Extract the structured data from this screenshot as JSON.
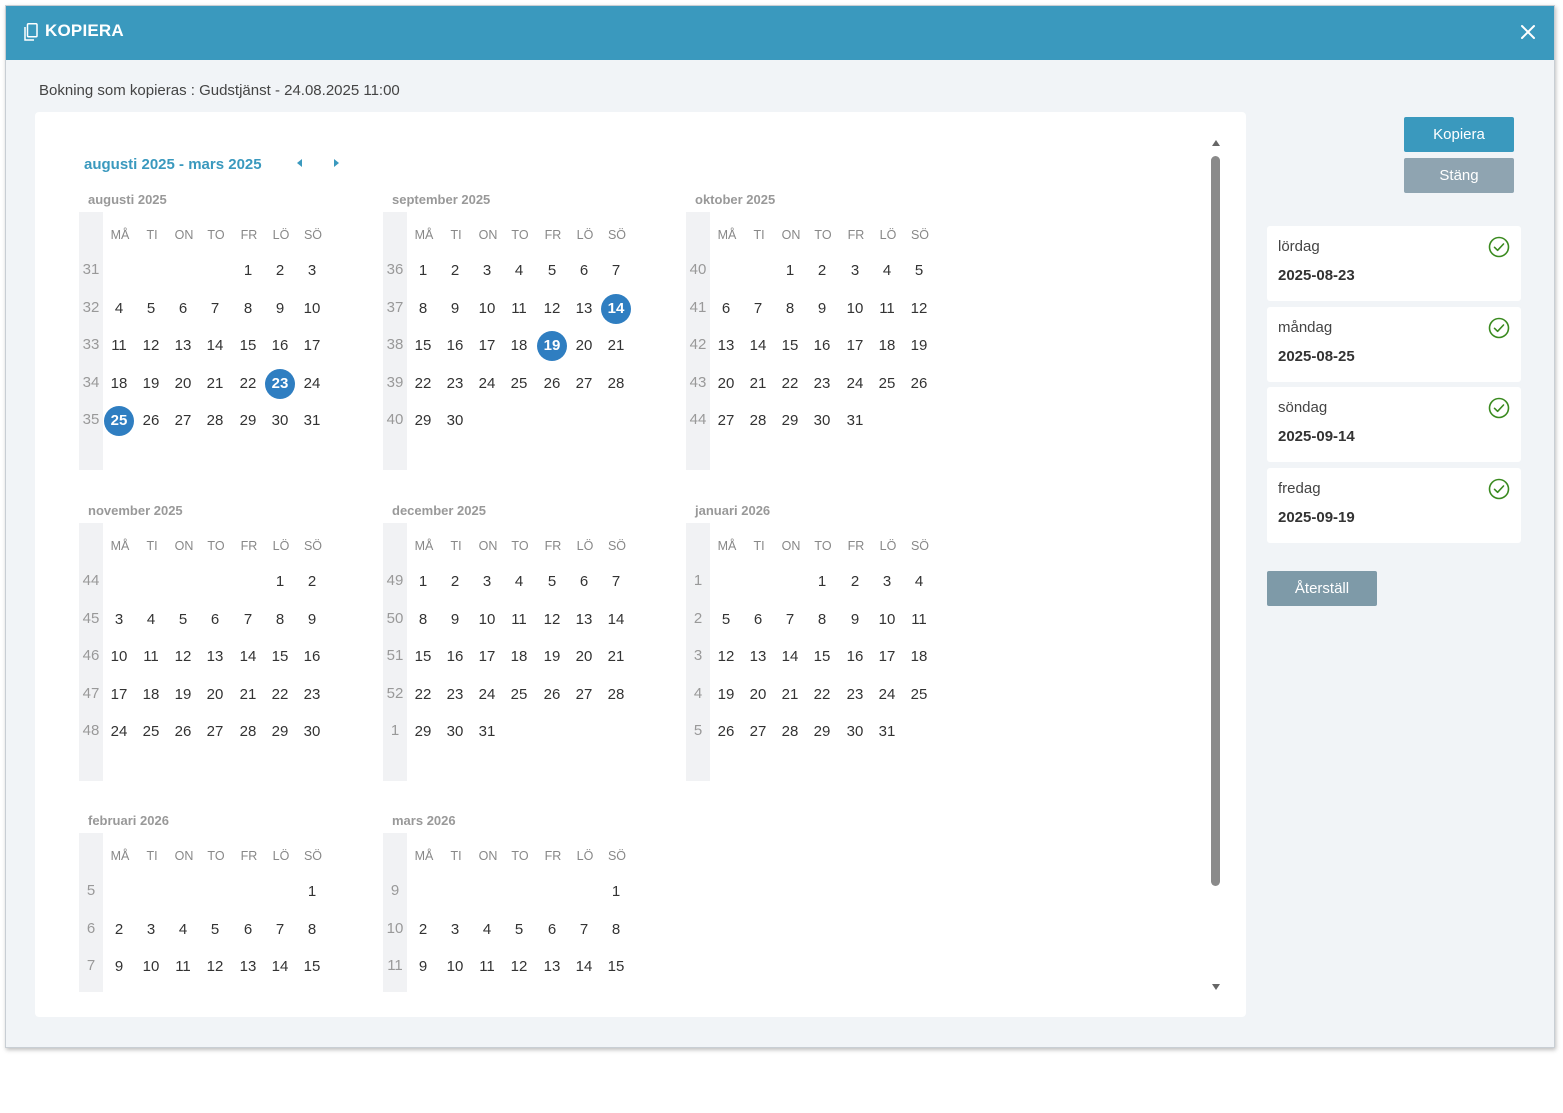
{
  "dialog": {
    "title": "KOPIERA",
    "subtitle": "Bokning som kopieras : Gudstjänst - 24.08.2025 11:00"
  },
  "calendar": {
    "range_title": "augusti 2025 - mars 2025",
    "weekdays": [
      "MÅ",
      "TI",
      "ON",
      "TO",
      "FR",
      "LÖ",
      "SÖ"
    ],
    "months": [
      {
        "title": "augusti 2025",
        "weeks": [
          {
            "wk": "31",
            "days": [
              "",
              "",
              "",
              "",
              "1",
              "2",
              "3"
            ]
          },
          {
            "wk": "32",
            "days": [
              "4",
              "5",
              "6",
              "7",
              "8",
              "9",
              "10"
            ]
          },
          {
            "wk": "33",
            "days": [
              "11",
              "12",
              "13",
              "14",
              "15",
              "16",
              "17"
            ]
          },
          {
            "wk": "34",
            "days": [
              "18",
              "19",
              "20",
              "21",
              "22",
              "23",
              "24"
            ]
          },
          {
            "wk": "35",
            "days": [
              "25",
              "26",
              "27",
              "28",
              "29",
              "30",
              "31"
            ]
          }
        ],
        "selected": [
          "23",
          "25"
        ]
      },
      {
        "title": "september 2025",
        "weeks": [
          {
            "wk": "36",
            "days": [
              "1",
              "2",
              "3",
              "4",
              "5",
              "6",
              "7"
            ]
          },
          {
            "wk": "37",
            "days": [
              "8",
              "9",
              "10",
              "11",
              "12",
              "13",
              "14"
            ]
          },
          {
            "wk": "38",
            "days": [
              "15",
              "16",
              "17",
              "18",
              "19",
              "20",
              "21"
            ]
          },
          {
            "wk": "39",
            "days": [
              "22",
              "23",
              "24",
              "25",
              "26",
              "27",
              "28"
            ]
          },
          {
            "wk": "40",
            "days": [
              "29",
              "30",
              "",
              "",
              "",
              "",
              ""
            ]
          }
        ],
        "selected": [
          "14",
          "19"
        ]
      },
      {
        "title": "oktober 2025",
        "weeks": [
          {
            "wk": "40",
            "days": [
              "",
              "",
              "1",
              "2",
              "3",
              "4",
              "5"
            ]
          },
          {
            "wk": "41",
            "days": [
              "6",
              "7",
              "8",
              "9",
              "10",
              "11",
              "12"
            ]
          },
          {
            "wk": "42",
            "days": [
              "13",
              "14",
              "15",
              "16",
              "17",
              "18",
              "19"
            ]
          },
          {
            "wk": "43",
            "days": [
              "20",
              "21",
              "22",
              "23",
              "24",
              "25",
              "26"
            ]
          },
          {
            "wk": "44",
            "days": [
              "27",
              "28",
              "29",
              "30",
              "31",
              "",
              ""
            ]
          }
        ],
        "selected": []
      },
      {
        "title": "november 2025",
        "weeks": [
          {
            "wk": "44",
            "days": [
              "",
              "",
              "",
              "",
              "",
              "1",
              "2"
            ]
          },
          {
            "wk": "45",
            "days": [
              "3",
              "4",
              "5",
              "6",
              "7",
              "8",
              "9"
            ]
          },
          {
            "wk": "46",
            "days": [
              "10",
              "11",
              "12",
              "13",
              "14",
              "15",
              "16"
            ]
          },
          {
            "wk": "47",
            "days": [
              "17",
              "18",
              "19",
              "20",
              "21",
              "22",
              "23"
            ]
          },
          {
            "wk": "48",
            "days": [
              "24",
              "25",
              "26",
              "27",
              "28",
              "29",
              "30"
            ]
          }
        ],
        "selected": []
      },
      {
        "title": "december 2025",
        "weeks": [
          {
            "wk": "49",
            "days": [
              "1",
              "2",
              "3",
              "4",
              "5",
              "6",
              "7"
            ]
          },
          {
            "wk": "50",
            "days": [
              "8",
              "9",
              "10",
              "11",
              "12",
              "13",
              "14"
            ]
          },
          {
            "wk": "51",
            "days": [
              "15",
              "16",
              "17",
              "18",
              "19",
              "20",
              "21"
            ]
          },
          {
            "wk": "52",
            "days": [
              "22",
              "23",
              "24",
              "25",
              "26",
              "27",
              "28"
            ]
          },
          {
            "wk": "1",
            "days": [
              "29",
              "30",
              "31",
              "",
              "",
              "",
              ""
            ]
          }
        ],
        "selected": []
      },
      {
        "title": "januari 2026",
        "weeks": [
          {
            "wk": "1",
            "days": [
              "",
              "",
              "",
              "1",
              "2",
              "3",
              "4"
            ]
          },
          {
            "wk": "2",
            "days": [
              "5",
              "6",
              "7",
              "8",
              "9",
              "10",
              "11"
            ]
          },
          {
            "wk": "3",
            "days": [
              "12",
              "13",
              "14",
              "15",
              "16",
              "17",
              "18"
            ]
          },
          {
            "wk": "4",
            "days": [
              "19",
              "20",
              "21",
              "22",
              "23",
              "24",
              "25"
            ]
          },
          {
            "wk": "5",
            "days": [
              "26",
              "27",
              "28",
              "29",
              "30",
              "31",
              ""
            ]
          }
        ],
        "selected": []
      },
      {
        "title": "februari 2026",
        "weeks": [
          {
            "wk": "5",
            "days": [
              "",
              "",
              "",
              "",
              "",
              "",
              "1"
            ]
          },
          {
            "wk": "6",
            "days": [
              "2",
              "3",
              "4",
              "5",
              "6",
              "7",
              "8"
            ]
          },
          {
            "wk": "7",
            "days": [
              "9",
              "10",
              "11",
              "12",
              "13",
              "14",
              "15"
            ]
          }
        ],
        "selected": []
      },
      {
        "title": "mars 2026",
        "weeks": [
          {
            "wk": "9",
            "days": [
              "",
              "",
              "",
              "",
              "",
              "",
              "1"
            ]
          },
          {
            "wk": "10",
            "days": [
              "2",
              "3",
              "4",
              "5",
              "6",
              "7",
              "8"
            ]
          },
          {
            "wk": "11",
            "days": [
              "9",
              "10",
              "11",
              "12",
              "13",
              "14",
              "15"
            ]
          }
        ],
        "selected": []
      }
    ]
  },
  "actions": {
    "copy_label": "Kopiera",
    "close_label": "Stäng",
    "reset_label": "Återställ"
  },
  "selected_dates": [
    {
      "weekday": "lördag",
      "date": "2025-08-23"
    },
    {
      "weekday": "måndag",
      "date": "2025-08-25"
    },
    {
      "weekday": "söndag",
      "date": "2025-09-14"
    },
    {
      "weekday": "fredag",
      "date": "2025-09-19"
    }
  ],
  "colors": {
    "header": "#3a99be",
    "selected_day": "#2f7ec1",
    "check": "#3a8a1f"
  },
  "icons": {
    "title": "copy-icon",
    "close": "close-icon",
    "prev": "caret-left-icon",
    "next": "caret-right-icon",
    "card_status": "check-circle-icon"
  }
}
